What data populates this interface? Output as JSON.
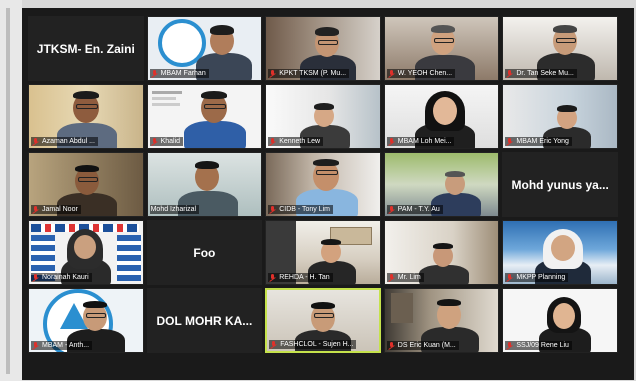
{
  "meeting": {
    "tiles": [
      {
        "id": "t1",
        "type": "text",
        "label": "JTKSM- En. Zaini",
        "nameplate": ""
      },
      {
        "id": "t2",
        "type": "video",
        "nameplate": "MBAM Farhan",
        "muted": true
      },
      {
        "id": "t3",
        "type": "video",
        "nameplate": "KPKT TKSM (P. Mu...",
        "muted": true
      },
      {
        "id": "t4",
        "type": "video",
        "nameplate": "W. YEOH Chen...",
        "muted": true
      },
      {
        "id": "t5",
        "type": "video",
        "nameplate": "Dr. Tan Seke Mu...",
        "muted": true
      },
      {
        "id": "t6",
        "type": "video",
        "nameplate": "Azaman Abdul ...",
        "muted": true
      },
      {
        "id": "t7",
        "type": "video",
        "nameplate": "Khalid",
        "muted": true
      },
      {
        "id": "t8",
        "type": "video",
        "nameplate": "Kenneth Lew",
        "muted": true
      },
      {
        "id": "t9",
        "type": "video",
        "nameplate": "MBAM Loh Mei...",
        "muted": true
      },
      {
        "id": "t10",
        "type": "video",
        "nameplate": "MBAM Eric Yong",
        "muted": true
      },
      {
        "id": "t11",
        "type": "video",
        "nameplate": "Jamal Noor",
        "muted": true
      },
      {
        "id": "t12",
        "type": "video",
        "nameplate": "Mohd Izharizal",
        "muted": false
      },
      {
        "id": "t13",
        "type": "video",
        "nameplate": "CIDB - Tony Lim",
        "muted": true
      },
      {
        "id": "t14",
        "type": "video",
        "nameplate": "PAM - T.Y. Au",
        "muted": true
      },
      {
        "id": "t15",
        "type": "text",
        "label": "Mohd yunus ya...",
        "nameplate": ""
      },
      {
        "id": "t16",
        "type": "video",
        "nameplate": "Norainah Kauri",
        "muted": true
      },
      {
        "id": "t17",
        "type": "text",
        "label": "Foo",
        "nameplate": ""
      },
      {
        "id": "t18",
        "type": "video",
        "nameplate": "REHDA - H. Tan",
        "muted": true
      },
      {
        "id": "t19",
        "type": "video",
        "nameplate": "Mr. Lim",
        "muted": true
      },
      {
        "id": "t20",
        "type": "video",
        "nameplate": "MKPP Planning",
        "muted": true
      },
      {
        "id": "t21",
        "type": "video",
        "nameplate": "MBAM - Anth...",
        "muted": true
      },
      {
        "id": "t22",
        "type": "text",
        "label": "DOL MOHR KA...",
        "nameplate": ""
      },
      {
        "id": "t23",
        "type": "video",
        "nameplate": "FASHCLOL - Sujen H...",
        "muted": true,
        "active": true
      },
      {
        "id": "t24",
        "type": "video",
        "nameplate": "DS Eric Kuan (M...",
        "muted": true
      },
      {
        "id": "t25",
        "type": "video",
        "nameplate": "SSJ/09 Rene Liu",
        "muted": true
      }
    ]
  },
  "colors": {
    "frame": "#1a1a1a",
    "active_border": "#c5e24b",
    "muted_mic": "#e0302a"
  }
}
